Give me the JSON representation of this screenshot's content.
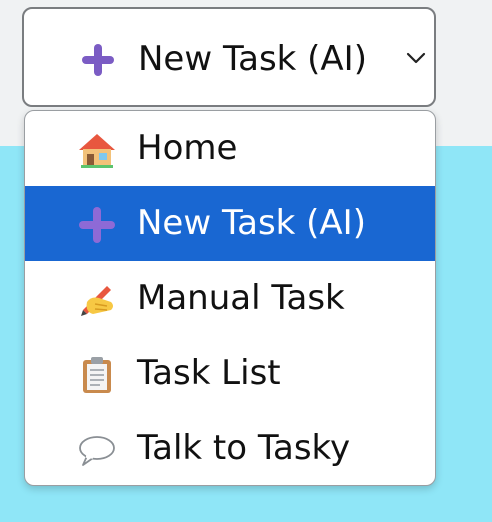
{
  "select": {
    "value": "New Task (AI)",
    "icon": "plus-icon"
  },
  "menu": {
    "items": [
      {
        "label": "Home",
        "icon": "house-icon",
        "selected": false
      },
      {
        "label": "New Task (AI)",
        "icon": "plus-icon",
        "selected": true
      },
      {
        "label": "Manual Task",
        "icon": "writing-hand-icon",
        "selected": false
      },
      {
        "label": "Task List",
        "icon": "clipboard-icon",
        "selected": false
      },
      {
        "label": "Talk to Tasky",
        "icon": "speech-bubble-icon",
        "selected": false
      }
    ]
  },
  "colors": {
    "background": "#8fe6f7",
    "selected": "#1967d2",
    "plus": "#7b5cc4"
  }
}
